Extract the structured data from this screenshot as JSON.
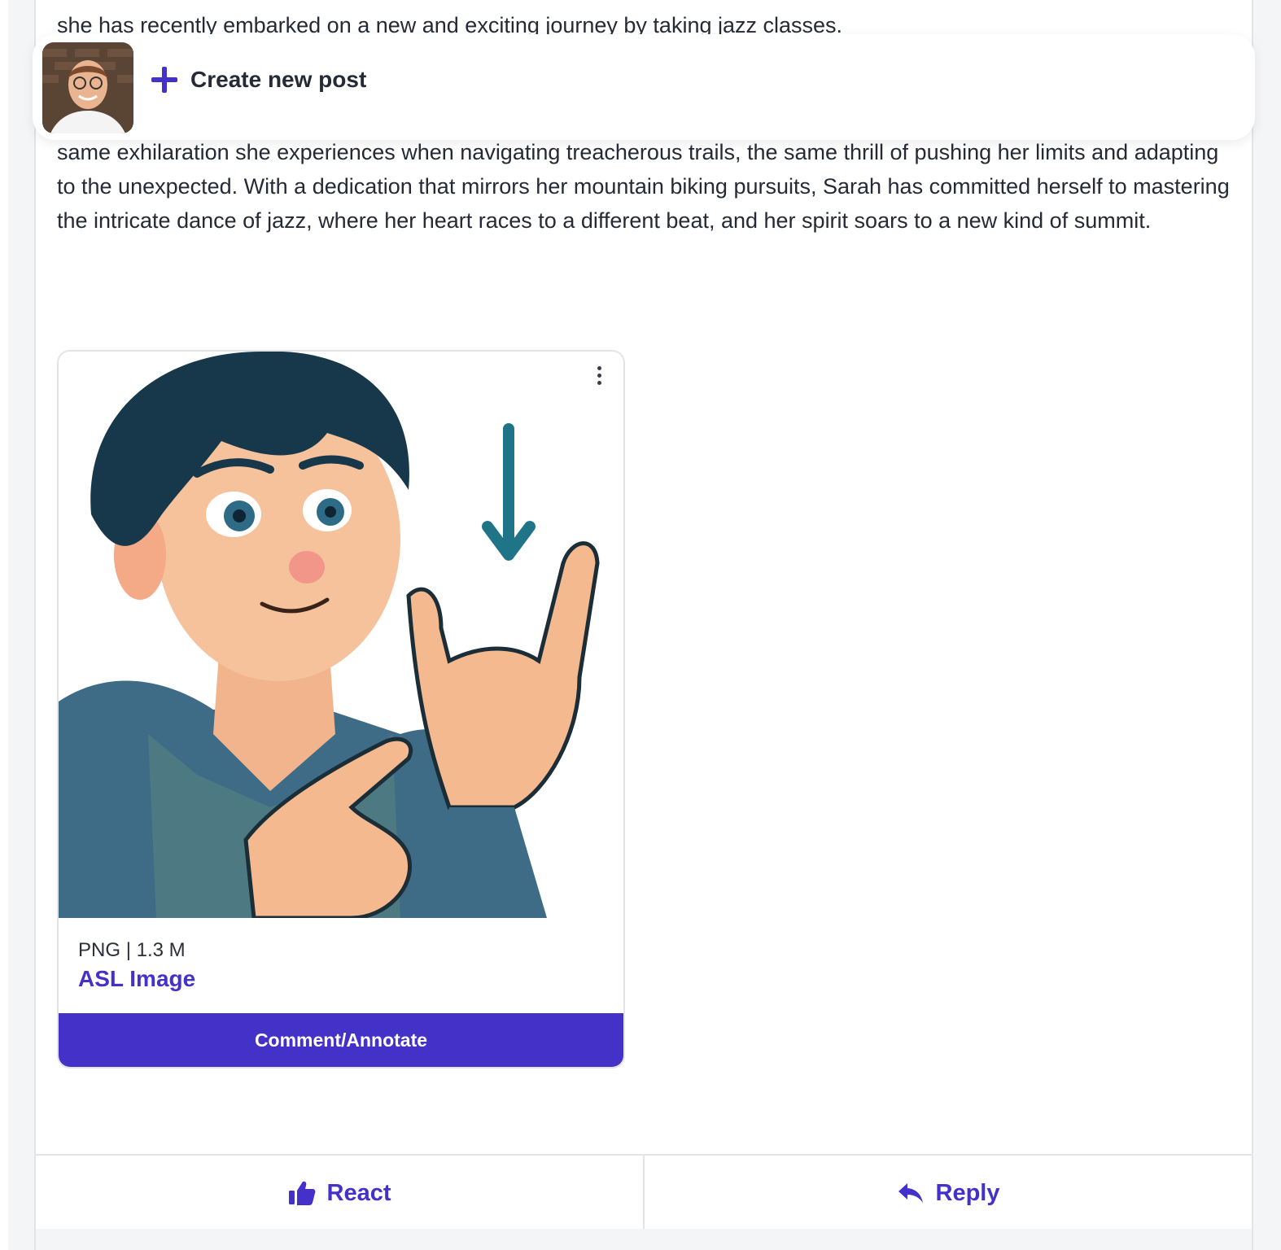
{
  "post": {
    "text_top_line": "she has recently embarked on a new and exciting journey by taking jazz classes.",
    "paragraph": "same exhilaration she experiences when navigating treacherous trails, the same thrill of pushing her limits and adapting to the unexpected. With a dedication that mirrors her mountain biking pursuits, Sarah has committed herself to mastering the intricate dance of jazz, where her heart races to a different beat, and her spirit soars to a new kind of summit."
  },
  "attachment": {
    "file_type": "PNG",
    "file_size": "1.3 M",
    "title": "ASL Image",
    "comment_button": "Comment/Annotate",
    "menu_icon": "kebab-menu-icon"
  },
  "actions": {
    "react_label": "React",
    "react_icon": "thumbs-up-icon",
    "reply_label": "Reply",
    "reply_icon": "reply-arrow-icon"
  },
  "create_post": {
    "label": "Create new post",
    "icon": "plus-icon"
  },
  "colors": {
    "accent": "#4431c8",
    "text": "#262a36",
    "border": "#e3e4e8"
  }
}
